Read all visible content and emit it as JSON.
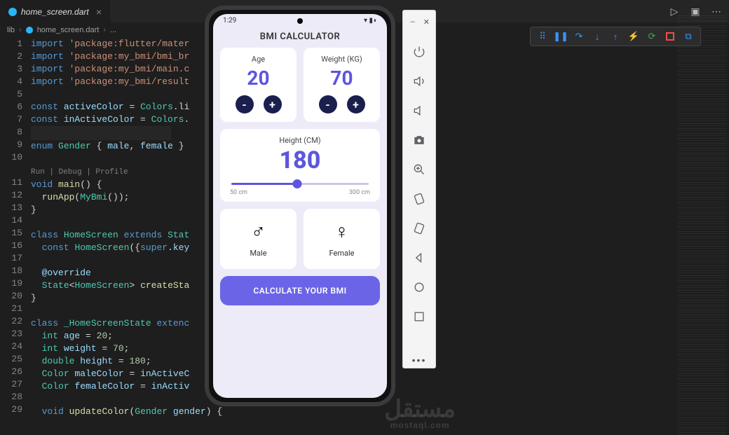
{
  "tab": {
    "filename": "home_screen.dart"
  },
  "breadcrumb": {
    "root": "lib",
    "file": "home_screen.dart",
    "trail": "..."
  },
  "debug_toolbar": {
    "icons": [
      "pause",
      "step-over",
      "step-into",
      "step-out",
      "hot-reload",
      "restart",
      "stop",
      "open-devtools"
    ]
  },
  "code": {
    "lines": [
      {
        "n": "1",
        "html": "<span class='kw'>import</span> <span class='str'>'package:flutter/mater</span>"
      },
      {
        "n": "2",
        "html": "<span class='kw'>import</span> <span class='str'>'package:my_bmi/bmi_br</span>"
      },
      {
        "n": "3",
        "html": "<span class='kw'>import</span> <span class='str'>'package:my_bmi/main.c</span>"
      },
      {
        "n": "4",
        "html": "<span class='kw'>import</span> <span class='str'>'package:my_bmi/result</span>"
      },
      {
        "n": "5",
        "html": ""
      },
      {
        "n": "6",
        "html": "<span class='kw'>const</span> <span class='var'>activeColor</span> = <span class='cls'>Colors</span>.li"
      },
      {
        "n": "7",
        "html": "<span class='kw'>const</span> <span class='var'>inActiveColor</span> = <span class='cls'>Colors</span>."
      },
      {
        "n": "8",
        "html": "<span class='cursor-line'>&nbsp;</span>"
      },
      {
        "n": "9",
        "html": "<span class='kw'>enum</span> <span class='cls'>Gender</span> { <span class='var'>male</span>, <span class='var'>female</span> }"
      },
      {
        "n": "10",
        "html": ""
      },
      {
        "n": "",
        "html": "<span class='codelens'>Run | Debug | Profile</span>"
      },
      {
        "n": "11",
        "html": "<span class='kw'>void</span> <span class='fn'>main</span>() {"
      },
      {
        "n": "12",
        "html": "  <span class='fn'>runApp</span>(<span class='cls'>MyBmi</span>());"
      },
      {
        "n": "13",
        "html": "}"
      },
      {
        "n": "14",
        "html": ""
      },
      {
        "n": "15",
        "html": "<span class='kw'>class</span> <span class='cls'>HomeScreen</span> <span class='kw'>extends</span> <span class='cls'>Stat</span>"
      },
      {
        "n": "16",
        "html": "  <span class='kw'>const</span> <span class='cls'>HomeScreen</span>({<span class='kw'>super</span>.<span class='var'>key</span>"
      },
      {
        "n": "17",
        "html": ""
      },
      {
        "n": "18",
        "html": "  <span class='var'>@override</span>"
      },
      {
        "n": "19",
        "html": "  <span class='cls'>State</span>&lt;<span class='cls'>HomeScreen</span>&gt; <span class='fn'>createSta</span>"
      },
      {
        "n": "20",
        "html": "}"
      },
      {
        "n": "21",
        "html": ""
      },
      {
        "n": "22",
        "html": "<span class='kw'>class</span> <span class='cls'>_HomeScreenState</span> <span class='kw'>extenc</span>"
      },
      {
        "n": "23",
        "html": "  <span class='cls'>int</span> <span class='var'>age</span> = <span class='num'>20</span>;"
      },
      {
        "n": "24",
        "html": "  <span class='cls'>int</span> <span class='var'>weight</span> = <span class='num'>70</span>;"
      },
      {
        "n": "25",
        "html": "  <span class='cls'>double</span> <span class='var'>height</span> = <span class='num'>180</span>;"
      },
      {
        "n": "26",
        "html": "  <span class='cls'>Color</span> <span class='var'>maleColor</span> = <span class='var'>inActiveC</span>"
      },
      {
        "n": "27",
        "html": "  <span class='cls'>Color</span> <span class='var'>femaleColor</span> = <span class='var'>inActiv</span>"
      },
      {
        "n": "28",
        "html": ""
      },
      {
        "n": "29",
        "html": "  <span class='kw'>void</span> <span class='fn'>updateColor</span>(<span class='cls'>Gender</span> <span class='var'>gender</span>) {"
      }
    ]
  },
  "emulator": {
    "status_time": "1:29",
    "status_icons": "▾ ▮◗",
    "app_title": "BMI CALCULATOR",
    "age": {
      "label": "Age",
      "value": "20",
      "minus": "-",
      "plus": "+"
    },
    "weight": {
      "label": "Weight (KG)",
      "value": "70",
      "minus": "-",
      "plus": "+"
    },
    "height": {
      "label": "Height (CM)",
      "value": "180",
      "min": "50 cm",
      "max": "300 cm"
    },
    "male": "Male",
    "female": "Female",
    "cta": "CALCULATE YOUR BMI"
  },
  "emu_panel": {
    "minimize": "–",
    "close": "✕",
    "dots": "•••"
  },
  "watermark": {
    "ar": "مستقل",
    "en": "mostaql.com"
  }
}
